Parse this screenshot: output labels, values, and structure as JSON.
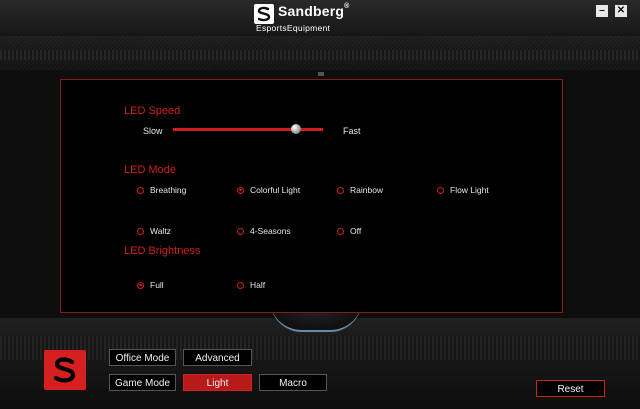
{
  "app": {
    "brand": "Sandberg",
    "brand_mark": "®",
    "sub_brand": "EsportsEquipment"
  },
  "window": {
    "minimize_label": "–",
    "close_label": "✕"
  },
  "led": {
    "speed": {
      "title": "LED Speed",
      "min_label": "Slow",
      "max_label": "Fast",
      "value_fraction": 0.82
    },
    "mode": {
      "title": "LED Mode",
      "options": [
        {
          "label": "Breathing",
          "checked": false
        },
        {
          "label": "Colorful Light",
          "checked": true
        },
        {
          "label": "Rainbow",
          "checked": false
        },
        {
          "label": "Flow Light",
          "checked": false
        },
        {
          "label": "Waltz",
          "checked": false
        },
        {
          "label": "4-Seasons",
          "checked": false
        },
        {
          "label": "Off",
          "checked": false
        }
      ]
    },
    "brightness": {
      "title": "LED Brightness",
      "options": [
        {
          "label": "Full",
          "checked": true
        },
        {
          "label": "Half",
          "checked": false
        }
      ]
    }
  },
  "footer": {
    "office_mode": "Office Mode",
    "advanced": "Advanced",
    "game_mode": "Game Mode",
    "light": "Light",
    "macro": "Macro",
    "reset": "Reset",
    "active_tab": "Light"
  },
  "colors": {
    "accent": "#d21f1f",
    "panel_border": "#8a1a1a",
    "background": "#0e0e0e"
  },
  "icons": {
    "brand_logo": "sandberg-s-logo-icon",
    "mouse_logo": "sandberg-logo-icon"
  }
}
